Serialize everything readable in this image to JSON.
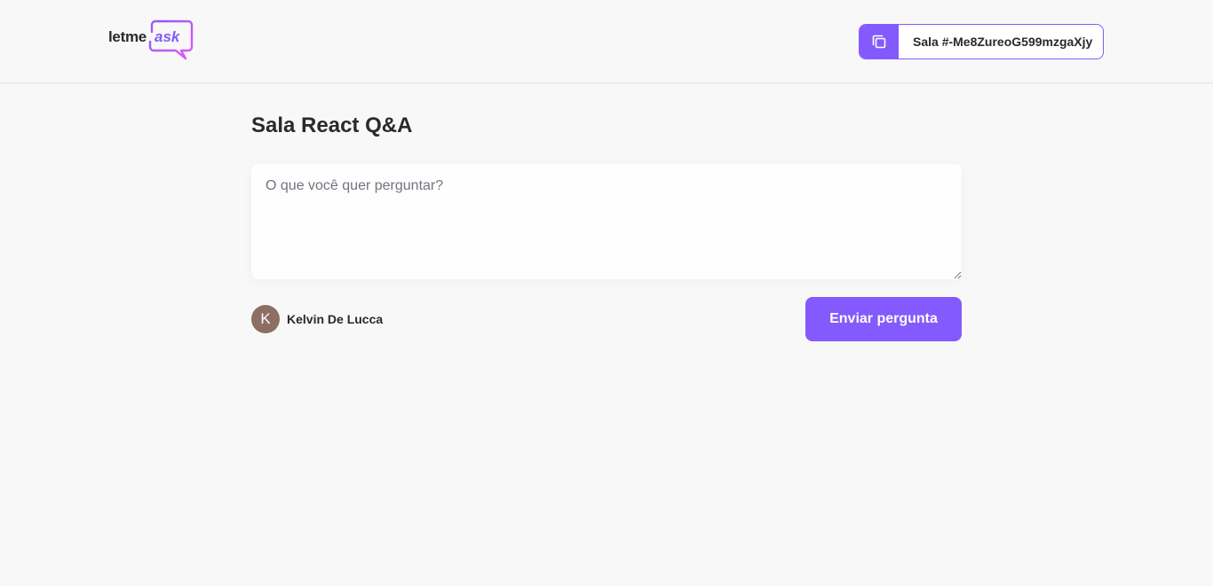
{
  "brand": {
    "logo_text_main": "letme",
    "logo_text_accent": "ask",
    "accent_color": "#835afd",
    "accent_gradient_end": "#e559f9"
  },
  "header": {
    "room_code_label": "Sala #-Me8ZureoG599mzgaXjy",
    "copy_icon": "copy-icon"
  },
  "main": {
    "title": "Sala React Q&A",
    "question_placeholder": "O que você quer perguntar?",
    "question_value": "",
    "user": {
      "avatar_initial": "K",
      "name": "Kelvin De Lucca"
    },
    "send_label": "Enviar pergunta"
  }
}
